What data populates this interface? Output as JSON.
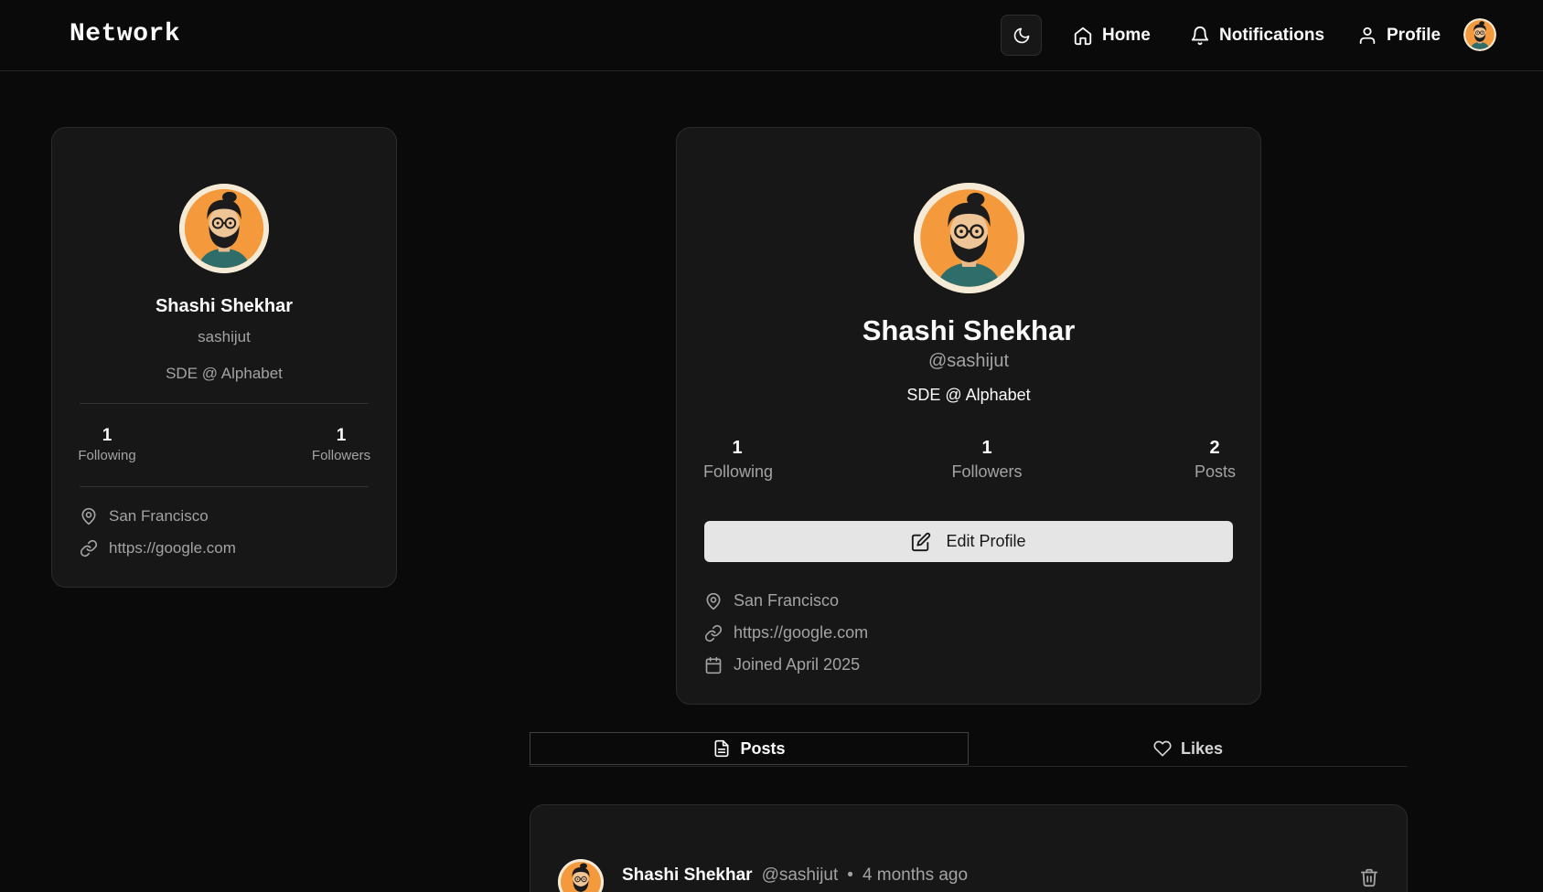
{
  "header": {
    "brand": "Network",
    "nav": {
      "home": "Home",
      "notifications": "Notifications",
      "profile": "Profile"
    },
    "theme_icon": "moon-icon"
  },
  "sidebar_card": {
    "name": "Shashi Shekhar",
    "username": "sashijut",
    "bio": "SDE @ Alphabet",
    "following_count": "1",
    "following_label": "Following",
    "followers_count": "1",
    "followers_label": "Followers",
    "location": "San Francisco",
    "website": "https://google.com"
  },
  "profile_card": {
    "name": "Shashi Shekhar",
    "handle": "@sashijut",
    "bio": "SDE @ Alphabet",
    "stats": [
      {
        "value": "1",
        "label": "Following"
      },
      {
        "value": "1",
        "label": "Followers"
      },
      {
        "value": "2",
        "label": "Posts"
      }
    ],
    "edit_label": "Edit Profile",
    "location": "San Francisco",
    "website": "https://google.com",
    "joined": "Joined April 2025"
  },
  "tabs": {
    "posts": "Posts",
    "likes": "Likes",
    "active": "posts"
  },
  "post": {
    "author": "Shashi Shekhar",
    "handle": "@sashijut",
    "separator": "•",
    "time": "4 months ago"
  },
  "colors": {
    "background": "#0a0a0a",
    "card": "#171717",
    "avatar_orange": "#f59a3c",
    "button_bg": "#e5e5e5"
  }
}
